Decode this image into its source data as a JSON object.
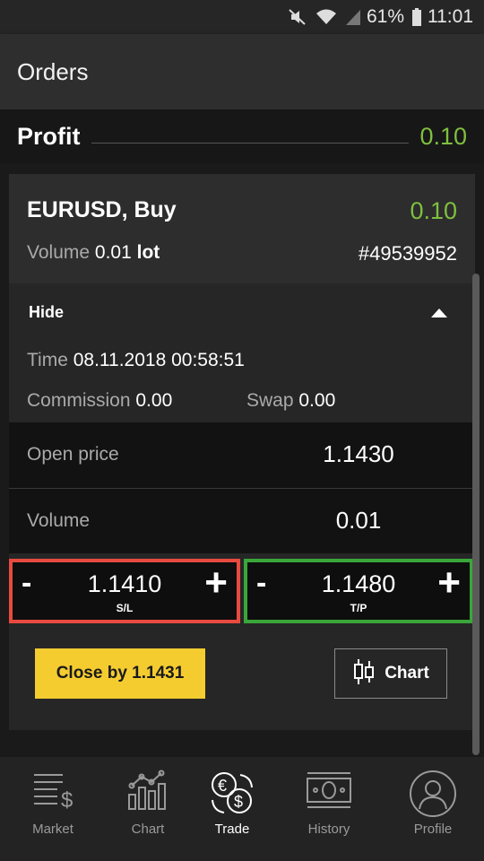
{
  "status_bar": {
    "battery": "61%",
    "time": "11:01"
  },
  "header": {
    "title": "Orders"
  },
  "profit": {
    "label": "Profit",
    "value": "0.10"
  },
  "order": {
    "symbol": "EURUSD, Buy",
    "profit": "0.10",
    "volume_label": "Volume",
    "volume_value": "0.01",
    "volume_unit": "lot",
    "ticket": "#49539952",
    "toggle_label": "Hide",
    "time_label": "Time",
    "time_value": "08.11.2018 00:58:51",
    "commission_label": "Commission",
    "commission_value": "0.00",
    "swap_label": "Swap",
    "swap_value": "0.00",
    "open_price_label": "Open price",
    "open_price_value": "1.1430",
    "volume_row_label": "Volume",
    "volume_row_value": "0.01",
    "sl": {
      "minus": "-",
      "value": "1.1410",
      "plus": "+",
      "caption": "S/L"
    },
    "tp": {
      "minus": "-",
      "value": "1.1480",
      "plus": "+",
      "caption": "T/P"
    },
    "close_button": "Close by 1.1431",
    "chart_button": "Chart"
  },
  "nav": [
    {
      "label": "Market",
      "icon": "market-icon"
    },
    {
      "label": "Chart",
      "icon": "chart-icon"
    },
    {
      "label": "Trade",
      "icon": "trade-icon",
      "active": true
    },
    {
      "label": "History",
      "icon": "history-icon"
    },
    {
      "label": "Profile",
      "icon": "profile-icon"
    }
  ],
  "colors": {
    "profit_green": "#7fbf3f",
    "sl_red": "#e84a3f",
    "tp_green": "#3aa63a",
    "close_yellow": "#f5cc30"
  }
}
